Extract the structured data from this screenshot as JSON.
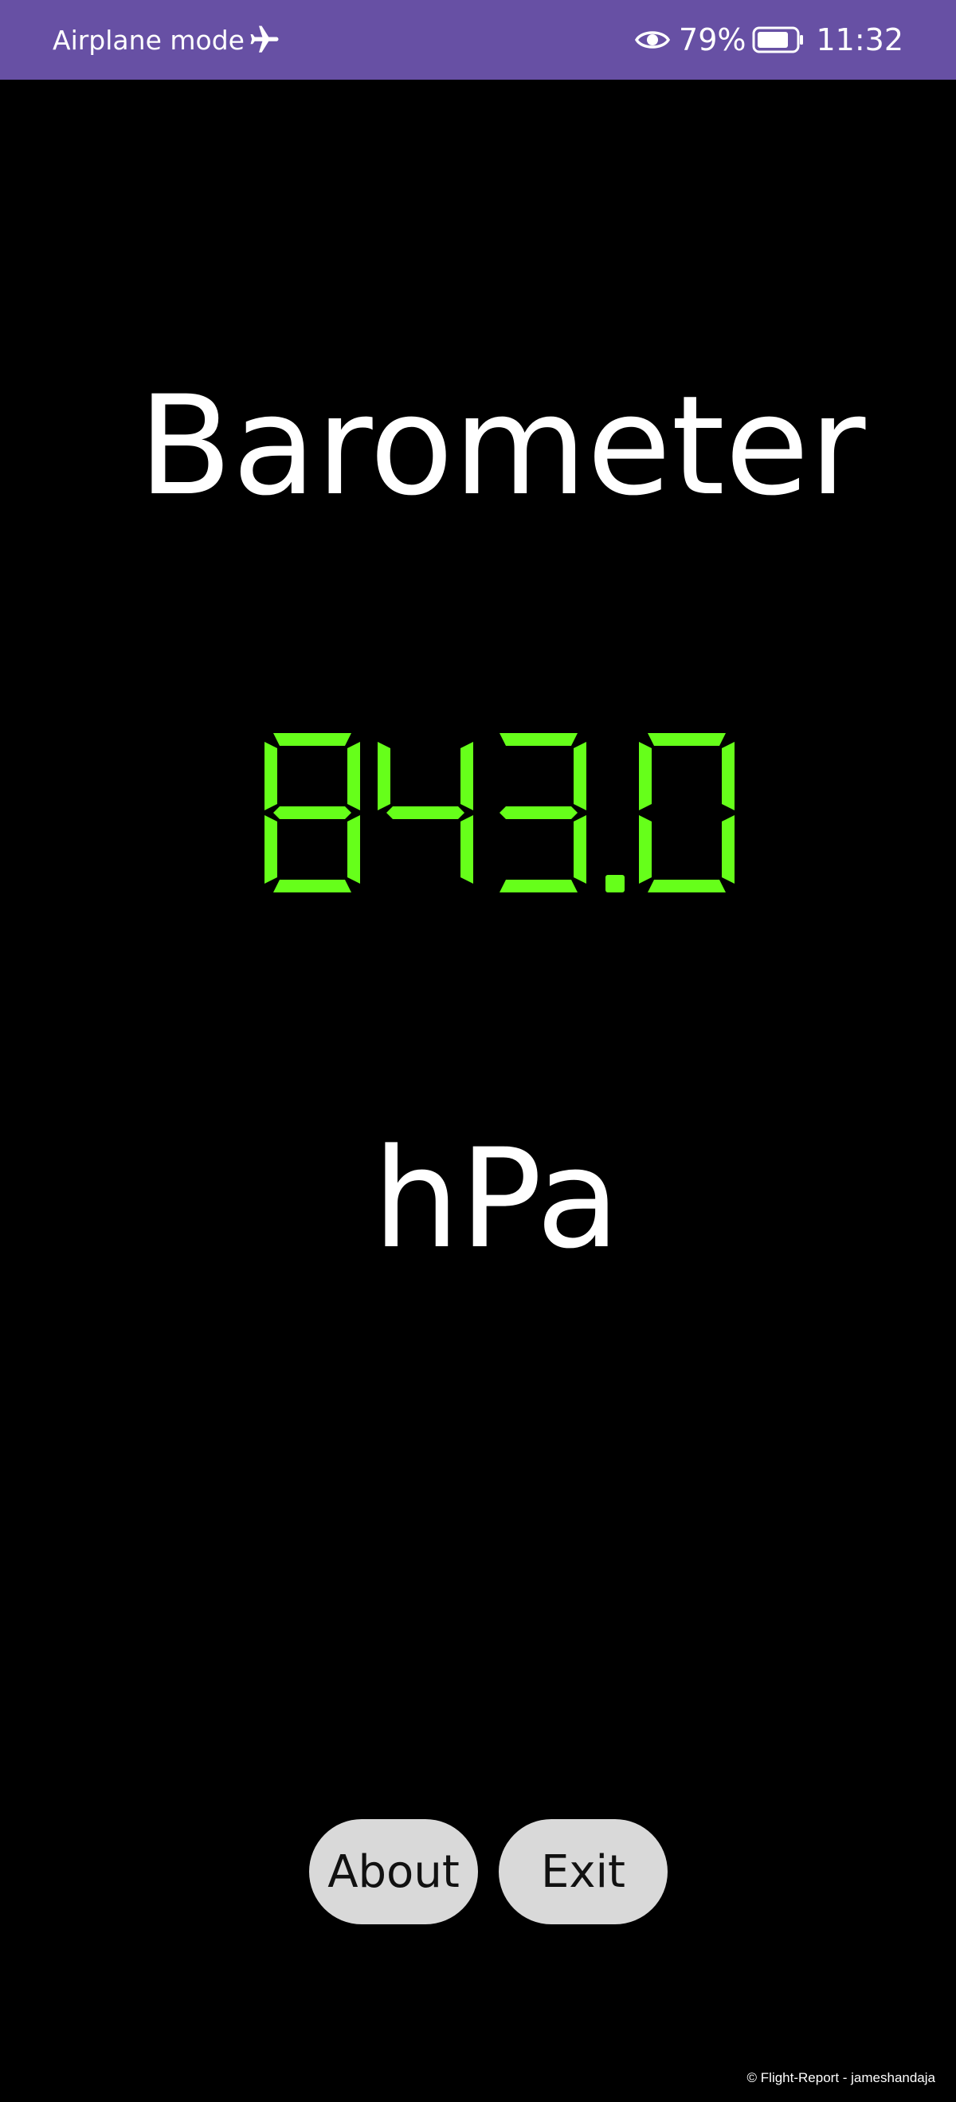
{
  "status_bar": {
    "mode_label": "Airplane mode",
    "battery": "79%",
    "time": "11:32",
    "background": "#6750a4",
    "icons": [
      "airplane-icon",
      "eye-icon",
      "battery-icon"
    ]
  },
  "app": {
    "title": "Barometer",
    "reading": "843.0",
    "reading_color": "#66ff1a",
    "unit": "hPa"
  },
  "buttons": {
    "about": "About",
    "exit": "Exit"
  },
  "footer": "© Flight-Report - jameshandaja"
}
